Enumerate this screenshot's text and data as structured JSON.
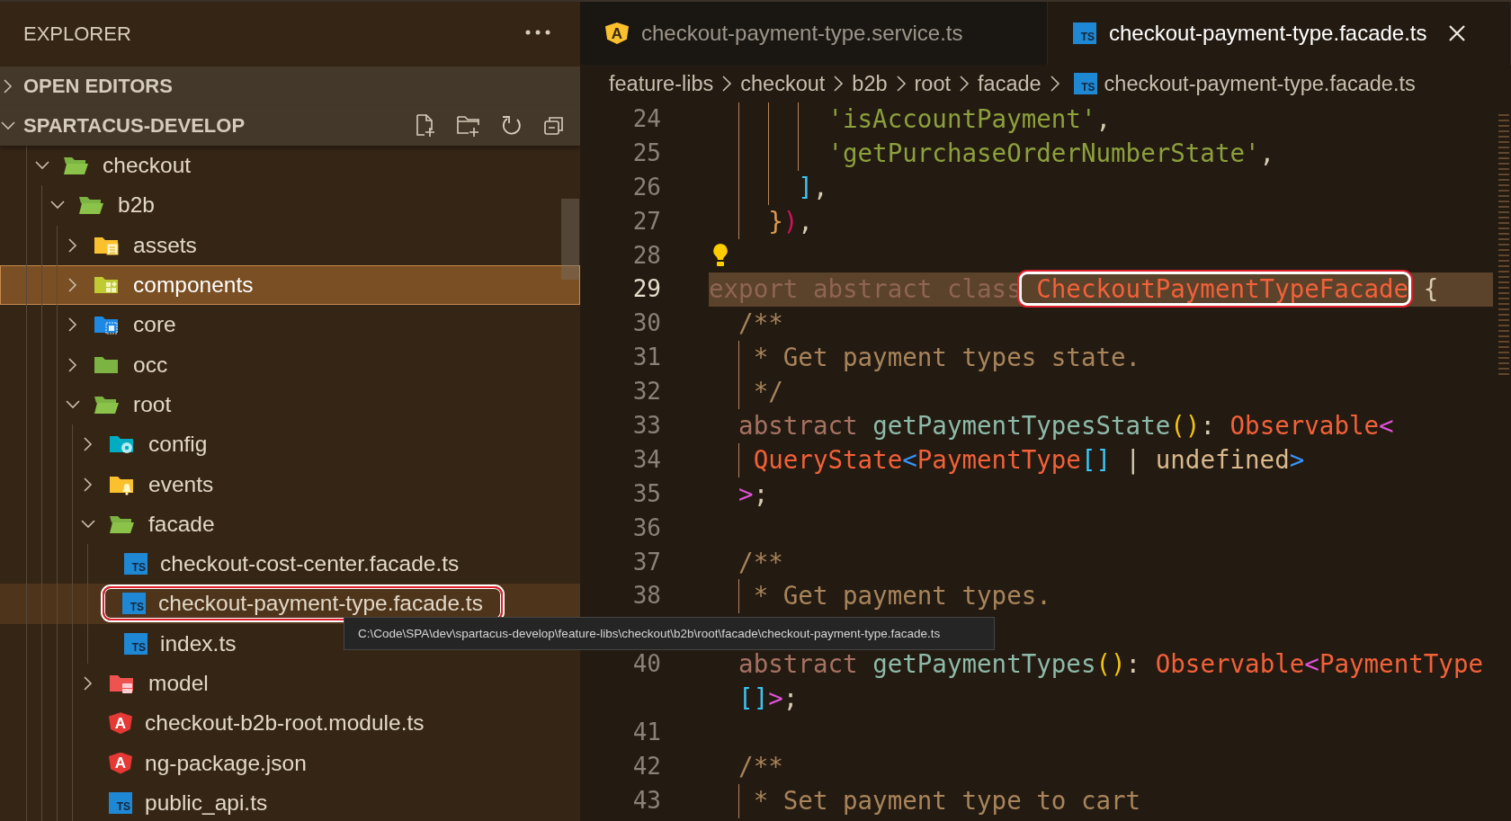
{
  "sidebar": {
    "title": "EXPLORER",
    "sections": [
      {
        "label": "OPEN EDITORS",
        "expanded": false
      },
      {
        "label": "SPARTACUS-DEVELOP",
        "expanded": true
      }
    ],
    "tree": [
      {
        "label": "checkout",
        "kind": "open-folder",
        "expanded": true,
        "selected": false,
        "hovered": false,
        "annotated": false,
        "children": [
          {
            "label": "b2b",
            "kind": "open-folder",
            "expanded": true,
            "selected": false,
            "hovered": false,
            "annotated": false,
            "children": [
              {
                "label": "assets",
                "kind": "document-folder",
                "expanded": false,
                "selected": false,
                "hovered": false,
                "annotated": false
              },
              {
                "label": "components",
                "kind": "blocks-folder",
                "expanded": false,
                "selected": true,
                "hovered": false,
                "annotated": false
              },
              {
                "label": "core",
                "kind": "chip-folder",
                "expanded": false,
                "selected": false,
                "hovered": false,
                "annotated": false
              },
              {
                "label": "occ",
                "kind": "folder",
                "expanded": false,
                "selected": false,
                "hovered": false,
                "annotated": false
              },
              {
                "label": "root",
                "kind": "open-folder",
                "expanded": true,
                "selected": false,
                "hovered": false,
                "annotated": false,
                "children": [
                  {
                    "label": "config",
                    "kind": "gear-folder",
                    "expanded": false,
                    "selected": false,
                    "hovered": false,
                    "annotated": false
                  },
                  {
                    "label": "events",
                    "kind": "bell-folder",
                    "expanded": false,
                    "selected": false,
                    "hovered": false,
                    "annotated": false
                  },
                  {
                    "label": "facade",
                    "kind": "open-folder",
                    "expanded": true,
                    "selected": false,
                    "hovered": false,
                    "annotated": false,
                    "children": [
                      {
                        "label": "checkout-cost-center.facade.ts",
                        "kind": "ts-file",
                        "icon_text": "TS",
                        "selected": false,
                        "hovered": false,
                        "annotated": false
                      },
                      {
                        "label": "checkout-payment-type.facade.ts",
                        "kind": "ts-file",
                        "icon_text": "TS",
                        "selected": false,
                        "hovered": true,
                        "annotated": true
                      },
                      {
                        "label": "index.ts",
                        "kind": "ts-file",
                        "icon_text": "TS",
                        "selected": false,
                        "hovered": false,
                        "annotated": false
                      }
                    ]
                  },
                  {
                    "label": "model",
                    "kind": "table-folder",
                    "expanded": false,
                    "selected": false,
                    "hovered": false,
                    "annotated": false
                  },
                  {
                    "label": "checkout-b2b-root.module.ts",
                    "kind": "shield-file",
                    "icon_text": "A",
                    "selected": false,
                    "hovered": false,
                    "annotated": false
                  },
                  {
                    "label": "ng-package.json",
                    "kind": "shield-file",
                    "icon_text": "A",
                    "selected": false,
                    "hovered": false,
                    "annotated": false
                  },
                  {
                    "label": "public_api.ts",
                    "kind": "ts-file",
                    "icon_text": "TS",
                    "selected": false,
                    "hovered": false,
                    "annotated": false
                  }
                ]
              }
            ]
          }
        ]
      }
    ],
    "tooltip": "C:\\Code\\SPA\\dev\\spartacus-develop\\feature-libs\\checkout\\b2b\\root\\facade\\checkout-payment-type.facade.ts"
  },
  "tabs": [
    {
      "label": "checkout-payment-type.service.ts",
      "kind": "shield-file",
      "icon_text": "A",
      "selected": false
    },
    {
      "label": "checkout-payment-type.facade.ts",
      "kind": "ts-file",
      "icon_text": "TS",
      "selected": true
    }
  ],
  "breadcrumb": [
    {
      "label": "feature-libs"
    },
    {
      "label": "checkout"
    },
    {
      "label": "b2b"
    },
    {
      "label": "root"
    },
    {
      "label": "facade"
    },
    {
      "label": "checkout-payment-type.facade.ts",
      "kind": "ts-file",
      "icon_text": "TS"
    }
  ],
  "code": [
    {
      "kind": "line",
      "number": "24",
      "highlighted": false,
      "tokens": [
        {
          "text": "        'isAccountPayment'",
          "kind": "str"
        },
        {
          "text": ",",
          "kind": "punct"
        }
      ]
    },
    {
      "kind": "line",
      "number": "25",
      "highlighted": false,
      "tokens": [
        {
          "text": "        'getPurchaseOrderNumberState'",
          "kind": "str"
        },
        {
          "text": ",",
          "kind": "punct"
        }
      ]
    },
    {
      "kind": "line",
      "number": "26",
      "highlighted": false,
      "tokens": [
        {
          "text": "      ]",
          "kind": "b-cyan"
        },
        {
          "text": ",",
          "kind": "punct"
        }
      ]
    },
    {
      "kind": "line",
      "number": "27",
      "highlighted": false,
      "tokens": [
        {
          "text": "    }",
          "kind": "b-orange"
        },
        {
          "text": ")",
          "kind": "b-crimson"
        },
        {
          "text": ",",
          "kind": "punct"
        }
      ]
    },
    {
      "kind": "line",
      "number": "28",
      "highlighted": false,
      "lightbulb": true
    },
    {
      "kind": "line",
      "number": "29",
      "highlighted": true,
      "tokens": [
        {
          "text": "export abstract class",
          "kind": "kw"
        },
        {
          "text": " CheckoutPaymentTypeFacade",
          "kind": "type",
          "annotated": true
        },
        {
          "text": " {",
          "kind": "punct"
        }
      ]
    },
    {
      "kind": "line",
      "number": "30",
      "highlighted": false,
      "tokens": [
        {
          "text": "  /**",
          "kind": "com"
        }
      ]
    },
    {
      "kind": "line",
      "number": "31",
      "highlighted": false,
      "tokens": [
        {
          "text": "   * Get payment types state.",
          "kind": "com"
        }
      ]
    },
    {
      "kind": "line",
      "number": "32",
      "highlighted": false,
      "tokens": [
        {
          "text": "   */",
          "kind": "com"
        }
      ]
    },
    {
      "kind": "line",
      "number": "33",
      "highlighted": false,
      "tokens": [
        {
          "text": "  abstract",
          "kind": "kw"
        },
        {
          "text": " getPaymentTypesState",
          "kind": "fn"
        },
        {
          "text": "()",
          "kind": "b-yellow"
        },
        {
          "text": ": ",
          "kind": "punct"
        },
        {
          "text": "Observable",
          "kind": "type"
        },
        {
          "text": "<",
          "kind": "b-magenta"
        }
      ]
    },
    {
      "kind": "line",
      "number": "34",
      "highlighted": false,
      "tokens": [
        {
          "text": "   QueryState",
          "kind": "type"
        },
        {
          "text": "<",
          "kind": "b-blue"
        },
        {
          "text": "PaymentType",
          "kind": "type"
        },
        {
          "text": "[]",
          "kind": "b-cyan"
        },
        {
          "text": " | ",
          "kind": "punct"
        },
        {
          "text": "undefined",
          "kind": "plain"
        },
        {
          "text": ">",
          "kind": "b-blue"
        }
      ]
    },
    {
      "kind": "line",
      "number": "35",
      "highlighted": false,
      "tokens": [
        {
          "text": "  >",
          "kind": "b-magenta"
        },
        {
          "text": ";",
          "kind": "punct"
        }
      ]
    },
    {
      "kind": "line",
      "number": "36",
      "highlighted": false
    },
    {
      "kind": "line",
      "number": "37",
      "highlighted": false,
      "tokens": [
        {
          "text": "  /**",
          "kind": "com"
        }
      ]
    },
    {
      "kind": "line",
      "number": "38",
      "highlighted": false,
      "tokens": [
        {
          "text": "   * Get payment types.",
          "kind": "com"
        }
      ]
    },
    {
      "kind": "covered",
      "highlighted": false
    },
    {
      "kind": "line",
      "number": "40",
      "highlighted": false,
      "tokens": [
        {
          "text": "  abstract",
          "kind": "kw"
        },
        {
          "text": " getPaymentTypes",
          "kind": "fn"
        },
        {
          "text": "()",
          "kind": "b-yellow"
        },
        {
          "text": ": ",
          "kind": "punct"
        },
        {
          "text": "Observable",
          "kind": "type"
        },
        {
          "text": "<",
          "kind": "b-magenta"
        },
        {
          "text": "PaymentType",
          "kind": "type"
        }
      ],
      "wrapped": [
        {
          "text": "  []",
          "kind": "b-cyan"
        },
        {
          "text": ">",
          "kind": "b-magenta"
        },
        {
          "text": ";",
          "kind": "punct"
        }
      ]
    },
    {
      "kind": "line",
      "number": "41",
      "highlighted": false
    },
    {
      "kind": "line",
      "number": "42",
      "highlighted": false,
      "tokens": [
        {
          "text": "  /**",
          "kind": "com"
        }
      ]
    },
    {
      "kind": "line",
      "number": "43",
      "highlighted": false,
      "tokens": [
        {
          "text": "   * Set payment type to cart",
          "kind": "com"
        }
      ]
    }
  ]
}
